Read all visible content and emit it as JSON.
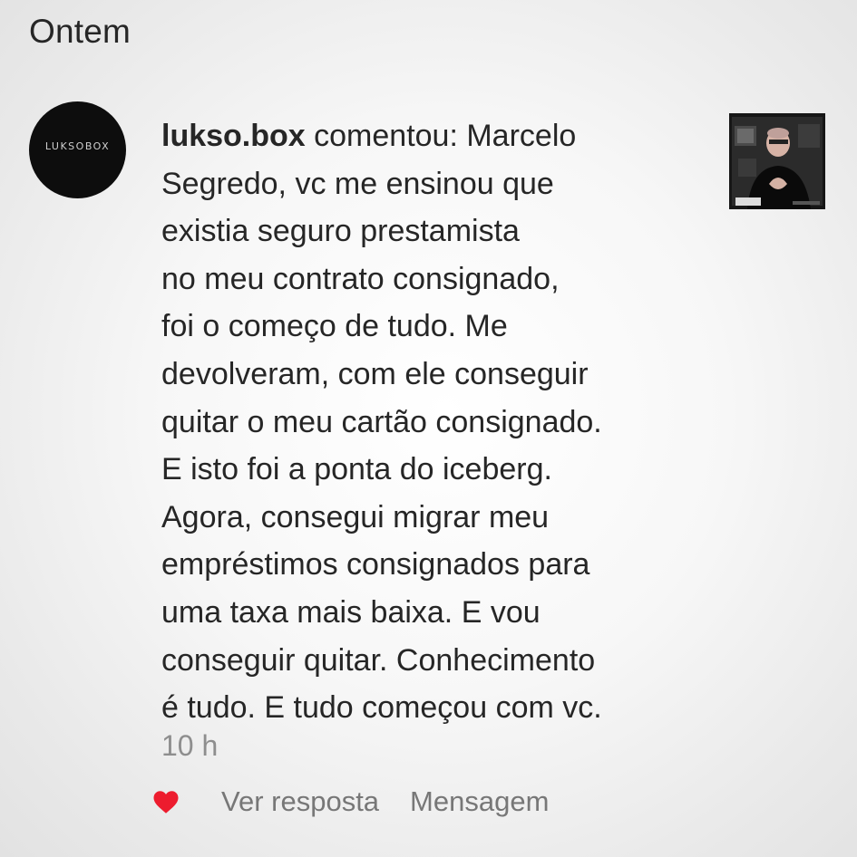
{
  "header": {
    "section_label": "Ontem"
  },
  "notification": {
    "avatar_text": "LUKSOBOX",
    "username": "lukso.box",
    "comment_lines": [
      " comentou: Marcelo",
      "Segredo, vc me ensinou que",
      "existia seguro prestamista",
      "no meu contrato consignado,",
      "foi o começo de tudo. Me",
      "devolveram, com ele conseguir",
      "quitar o meu cartão consignado.",
      "E isto foi a ponta do iceberg.",
      "Agora, consegui migrar meu",
      "empréstimos consignados para",
      "uma taxa mais baixa. E vou",
      "conseguir quitar. Conhecimento",
      "é tudo. E tudo começou com vc."
    ],
    "timestamp": "10 h",
    "thumbnail_icon": "video-thumbnail"
  },
  "actions": {
    "like_icon": "heart-icon",
    "like_color": "#ed1c2e",
    "view_reply_label": "Ver resposta",
    "message_label": "Mensagem"
  }
}
